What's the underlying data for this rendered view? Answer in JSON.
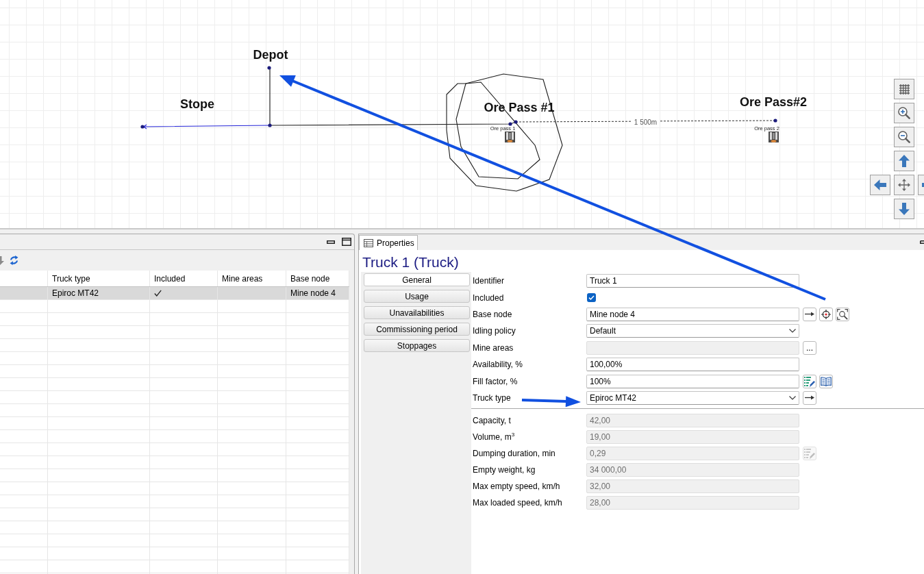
{
  "map": {
    "area_labels": [
      "Depot",
      "Stope",
      "Ore Pass #1",
      "Ore Pass#2"
    ],
    "ore_passes": [
      {
        "name": "Ore pass 1"
      },
      {
        "name": "Ore pass 2"
      }
    ],
    "distance": "1 500m"
  },
  "truck_table": {
    "columns": [
      "Truck type",
      "Included",
      "Mine areas",
      "Base node"
    ],
    "rows": [
      {
        "truck_type": "Epiroc MT42",
        "included": true,
        "base_node": "Mine node 4",
        "selected": true
      }
    ]
  },
  "properties": {
    "tab": {
      "label": "Properties",
      "selected": true
    },
    "title": "Truck 1 (Truck)",
    "sections": [
      {
        "label": "General",
        "selected": true
      },
      {
        "label": "Usage",
        "selected": false
      },
      {
        "label": "Unavailabilities",
        "selected": false
      },
      {
        "label": "Commissioning period",
        "selected": false
      },
      {
        "label": "Stoppages",
        "selected": false
      }
    ],
    "fields": [
      {
        "kind": "text",
        "label": "Identifier",
        "value": "Truck 1",
        "disabled": false
      },
      {
        "kind": "checkbox",
        "label": "Included",
        "checked": true,
        "disabled": false
      },
      {
        "kind": "text",
        "label": "Base node",
        "value": "Mine node 4",
        "disabled": false,
        "actions": [
          {
            "kind": "goto",
            "disabled": false
          },
          {
            "kind": "locate",
            "disabled": false
          },
          {
            "kind": "zoom",
            "disabled": false
          }
        ]
      },
      {
        "kind": "dropdown",
        "label": "Idling policy",
        "value": "Default",
        "disabled": false
      },
      {
        "kind": "text",
        "label": "Mine areas",
        "disabled": true,
        "actions": [
          {
            "kind": "browse",
            "label": "...",
            "disabled": false
          }
        ]
      },
      {
        "kind": "text",
        "label": "Availability, %",
        "value": "100,00%",
        "disabled": false
      },
      {
        "kind": "text",
        "label": "Fill factor, %",
        "value": "100%",
        "disabled": false,
        "actions": [
          {
            "kind": "edit",
            "disabled": false
          },
          {
            "kind": "book",
            "disabled": false
          }
        ]
      },
      {
        "kind": "dropdown",
        "label": "Truck type",
        "value": "Epiroc MT42",
        "disabled": false,
        "actions": [
          {
            "kind": "goto",
            "disabled": false
          }
        ]
      }
    ],
    "truck_type_details": [
      {
        "kind": "text",
        "label": "Capacity, t",
        "value": "42,00",
        "disabled": true
      },
      {
        "kind": "text",
        "label": "Volume, m$^{3}$",
        "value": "19,00",
        "disabled": true
      },
      {
        "kind": "text",
        "label": "Dumping duration, min",
        "value": "0,29",
        "disabled": true,
        "actions": [
          {
            "kind": "edit",
            "disabled": true
          }
        ]
      },
      {
        "kind": "text",
        "label": "Empty weight, kg",
        "value": "34 000,00",
        "disabled": true
      },
      {
        "kind": "text",
        "label": "Max empty speed, km/h",
        "value": "32,00",
        "disabled": true
      },
      {
        "kind": "text",
        "label": "Max loaded speed, km/h",
        "value": "28,00",
        "disabled": true
      }
    ]
  }
}
